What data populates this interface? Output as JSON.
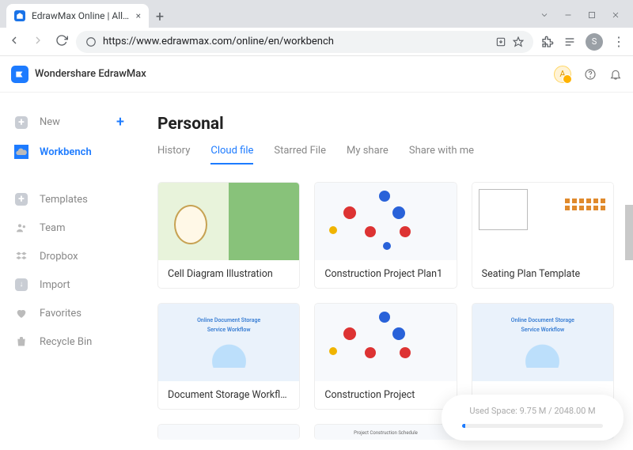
{
  "browser": {
    "tab_title": "EdrawMax Online | All-in-One Diag",
    "url": "https://www.edrawmax.com/online/en/workbench",
    "profile_initial": "S"
  },
  "app": {
    "brand": "Wondershare EdrawMax",
    "avatar_initial": "A"
  },
  "sidebar": {
    "items": [
      {
        "label": "New",
        "icon": "plus-square",
        "has_plus": true
      },
      {
        "label": "Workbench",
        "icon": "cloud",
        "active": true
      },
      {
        "label": "Templates",
        "icon": "plus-square"
      },
      {
        "label": "Team",
        "icon": "team"
      },
      {
        "label": "Dropbox",
        "icon": "dropbox"
      },
      {
        "label": "Import",
        "icon": "import"
      },
      {
        "label": "Favorites",
        "icon": "heart"
      },
      {
        "label": "Recycle Bin",
        "icon": "trash"
      }
    ]
  },
  "main": {
    "title": "Personal",
    "tabs": [
      "History",
      "Cloud file",
      "Starred File",
      "My share",
      "Share with me"
    ],
    "active_tab": 1,
    "cards": [
      {
        "title": "Cell Diagram Illustration"
      },
      {
        "title": "Construction Project Plan1"
      },
      {
        "title": "Seating Plan Template"
      },
      {
        "title": "Document Storage Workflo..."
      },
      {
        "title": "Construction Project"
      },
      {
        "title": ""
      }
    ]
  },
  "storage": {
    "label": "Used Space: 9.75 M / 2048.00 M"
  }
}
